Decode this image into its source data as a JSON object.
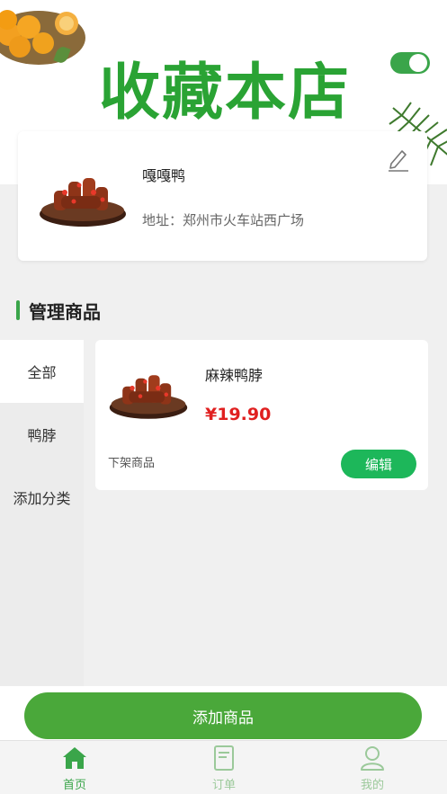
{
  "banner": {
    "title": "收藏本店",
    "toggle_on": true
  },
  "shop": {
    "name": "嘎嘎鸭",
    "address": "地址：郑州市火车站西广场"
  },
  "section": {
    "title": "管理商品"
  },
  "categories": [
    {
      "label": "全部",
      "active": true
    },
    {
      "label": "鸭脖",
      "active": false
    },
    {
      "label": "添加分类",
      "active": false
    }
  ],
  "product": {
    "name": "麻辣鸭脖",
    "price": "¥19.90",
    "off_label": "下架商品",
    "edit_label": "编辑"
  },
  "add_button": {
    "label": "添加商品"
  },
  "tabbar": [
    {
      "label": "首页",
      "icon": "home-icon",
      "active": true
    },
    {
      "label": "订单",
      "icon": "order-icon",
      "active": false
    },
    {
      "label": "我的",
      "icon": "user-icon",
      "active": false
    }
  ],
  "colors": {
    "accent": "#3aa54a",
    "price": "#e02020",
    "edit_button": "#1db75a"
  }
}
